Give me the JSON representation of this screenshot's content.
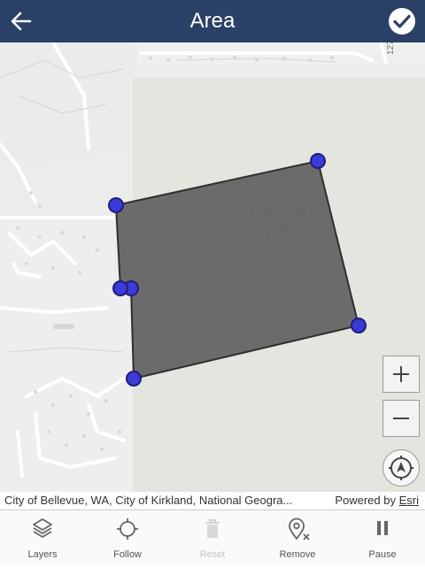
{
  "header": {
    "title": "Area",
    "back_icon": "arrow-left-icon",
    "confirm_icon": "check-circle-icon"
  },
  "map": {
    "park_label": [
      "Bridle Trails",
      "State",
      "Park"
    ],
    "road_label": "127",
    "polygon_color": "#6b6b6b",
    "vertex_color": "#3b3bd9"
  },
  "controls": {
    "zoom_in": "+",
    "zoom_out": "−",
    "locate_icon": "compass-icon"
  },
  "attribution": {
    "sources": "City of Bellevue, WA, City of Kirkland, National Geogra...",
    "powered_by": "Powered by",
    "esri": "Esri"
  },
  "toolbar": {
    "items": [
      {
        "label": "Layers",
        "icon": "layers-icon",
        "enabled": true
      },
      {
        "label": "Follow",
        "icon": "crosshair-icon",
        "enabled": true
      },
      {
        "label": "Reset",
        "icon": "trash-icon",
        "enabled": false
      },
      {
        "label": "Remove",
        "icon": "remove-point-icon",
        "enabled": true
      },
      {
        "label": "Pause",
        "icon": "pause-icon",
        "enabled": true
      }
    ]
  },
  "colors": {
    "header_bg": "#2b4066",
    "map_bg": "#ecedeb"
  }
}
